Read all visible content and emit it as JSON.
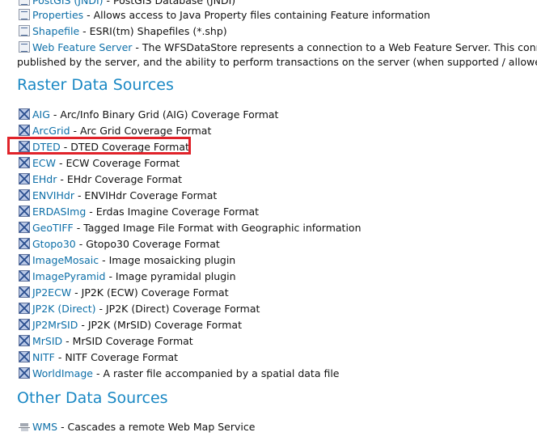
{
  "vector_top": [
    {
      "name": "PostGIS (JNDI)",
      "desc": " - PostGIS Database (JNDI)"
    },
    {
      "name": "Properties",
      "desc": " - Allows access to Java Property files containing Feature information"
    },
    {
      "name": "Shapefile",
      "desc": " - ESRI(tm) Shapefiles (*.shp)"
    },
    {
      "name": "Web Feature Server",
      "desc": " - The WFSDataStore represents a connection to a Web Feature Server. This connecti"
    }
  ],
  "wfs_continuation": "published by the server, and the ability to perform transactions on the server (when supported / allowed).",
  "raster_heading": "Raster Data Sources",
  "raster": [
    {
      "name": "AIG",
      "desc": " - Arc/Info Binary Grid (AIG) Coverage Format"
    },
    {
      "name": "ArcGrid",
      "desc": " - Arc Grid Coverage Format"
    },
    {
      "name": "DTED",
      "desc": " - DTED Coverage Format"
    },
    {
      "name": "ECW",
      "desc": " - ECW Coverage Format"
    },
    {
      "name": "EHdr",
      "desc": " - EHdr Coverage Format"
    },
    {
      "name": "ENVIHdr",
      "desc": " - ENVIHdr Coverage Format"
    },
    {
      "name": "ERDASImg",
      "desc": " - Erdas Imagine Coverage Format"
    },
    {
      "name": "GeoTIFF",
      "desc": " - Tagged Image File Format with Geographic information"
    },
    {
      "name": "Gtopo30",
      "desc": " - Gtopo30 Coverage Format"
    },
    {
      "name": "ImageMosaic",
      "desc": " - Image mosaicking plugin"
    },
    {
      "name": "ImagePyramid",
      "desc": " - Image pyramidal plugin"
    },
    {
      "name": "JP2ECW",
      "desc": " - JP2K (ECW) Coverage Format"
    },
    {
      "name": "JP2K (Direct)",
      "desc": " - JP2K (Direct) Coverage Format"
    },
    {
      "name": "JP2MrSID",
      "desc": " - JP2K (MrSID) Coverage Format"
    },
    {
      "name": "MrSID",
      "desc": " - MrSID Coverage Format"
    },
    {
      "name": "NITF",
      "desc": " - NITF Coverage Format"
    },
    {
      "name": "WorldImage",
      "desc": " - A raster file accompanied by a spatial data file"
    }
  ],
  "other_heading": "Other Data Sources",
  "other": [
    {
      "name": "WMS",
      "desc": " - Cascades a remote Web Map Service"
    }
  ],
  "colors": {
    "link": "#0d6fa8",
    "heading": "#1a88c4",
    "highlight": "#e0232a"
  }
}
